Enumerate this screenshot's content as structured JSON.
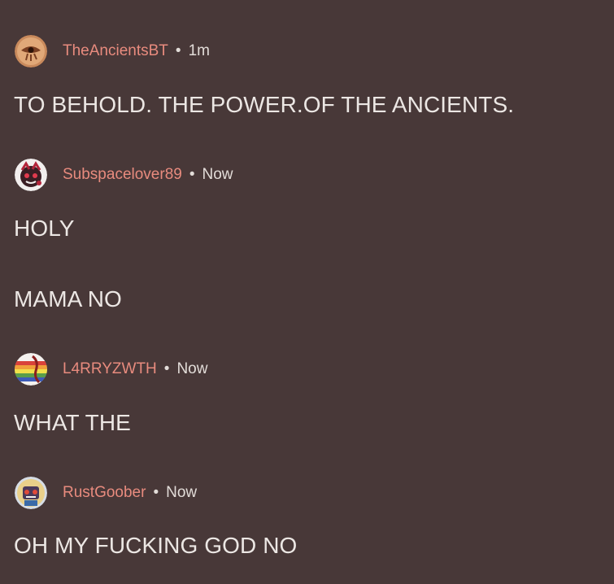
{
  "comments": [
    {
      "username": "TheAncientsBT",
      "separator": "•",
      "time": "1m",
      "avatar_icon": "eye-of-ra-avatar",
      "lines": [
        "TO BEHOLD. THE POWER.OF THE ANCIENTS."
      ]
    },
    {
      "username": "Subspacelover89",
      "separator": "•",
      "time": "Now",
      "avatar_icon": "character-avatar",
      "lines": [
        "HOLY",
        "MAMA NO"
      ]
    },
    {
      "username": "L4RRYZWTH",
      "separator": "•",
      "time": "Now",
      "avatar_icon": "rainbow-flag-avatar",
      "lines": [
        "WHAT THE"
      ]
    },
    {
      "username": "RustGoober",
      "separator": "•",
      "time": "Now",
      "avatar_icon": "robot-avatar",
      "lines": [
        "OH MY FUCKING GOD NO"
      ]
    }
  ],
  "colors": {
    "background": "#483838",
    "username": "#e88b7e",
    "text": "#ece7e4"
  }
}
